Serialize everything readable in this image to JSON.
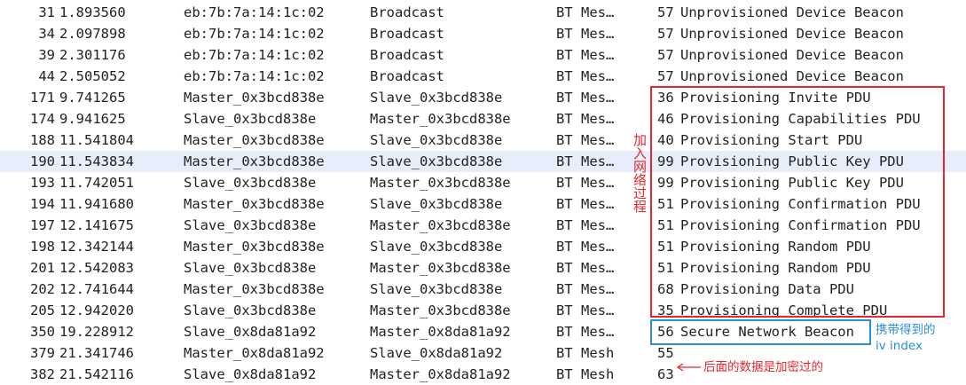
{
  "packets": [
    {
      "no": "31",
      "time": "1.893560",
      "source": "eb:7b:7a:14:1c:02",
      "destination": "Broadcast",
      "protocol": "BT Mes…",
      "length": "57",
      "info": "Unprovisioned Device Beacon"
    },
    {
      "no": "34",
      "time": "2.097898",
      "source": "eb:7b:7a:14:1c:02",
      "destination": "Broadcast",
      "protocol": "BT Mes…",
      "length": "57",
      "info": "Unprovisioned Device Beacon"
    },
    {
      "no": "39",
      "time": "2.301176",
      "source": "eb:7b:7a:14:1c:02",
      "destination": "Broadcast",
      "protocol": "BT Mes…",
      "length": "57",
      "info": "Unprovisioned Device Beacon"
    },
    {
      "no": "44",
      "time": "2.505052",
      "source": "eb:7b:7a:14:1c:02",
      "destination": "Broadcast",
      "protocol": "BT Mes…",
      "length": "57",
      "info": "Unprovisioned Device Beacon"
    },
    {
      "no": "171",
      "time": "9.741265",
      "source": "Master_0x3bcd838e",
      "destination": "Slave_0x3bcd838e",
      "protocol": "BT Mes…",
      "length": "36",
      "info": "Provisioning Invite PDU"
    },
    {
      "no": "174",
      "time": "9.941625",
      "source": "Slave_0x3bcd838e",
      "destination": "Master_0x3bcd838e",
      "protocol": "BT Mes…",
      "length": "46",
      "info": "Provisioning Capabilities PDU"
    },
    {
      "no": "188",
      "time": "11.541804",
      "source": "Master_0x3bcd838e",
      "destination": "Slave_0x3bcd838e",
      "protocol": "BT Mes…",
      "length": "40",
      "info": "Provisioning Start PDU"
    },
    {
      "no": "190",
      "time": "11.543834",
      "source": "Master_0x3bcd838e",
      "destination": "Slave_0x3bcd838e",
      "protocol": "BT Mes…",
      "length": "99",
      "info": "Provisioning Public Key PDU",
      "selected": true
    },
    {
      "no": "193",
      "time": "11.742051",
      "source": "Slave_0x3bcd838e",
      "destination": "Master_0x3bcd838e",
      "protocol": "BT Mes…",
      "length": "99",
      "info": "Provisioning Public Key PDU"
    },
    {
      "no": "194",
      "time": "11.941680",
      "source": "Master_0x3bcd838e",
      "destination": "Slave_0x3bcd838e",
      "protocol": "BT Mes…",
      "length": "51",
      "info": "Provisioning Confirmation PDU"
    },
    {
      "no": "197",
      "time": "12.141675",
      "source": "Slave_0x3bcd838e",
      "destination": "Master_0x3bcd838e",
      "protocol": "BT Mes…",
      "length": "51",
      "info": "Provisioning Confirmation PDU"
    },
    {
      "no": "198",
      "time": "12.342144",
      "source": "Master_0x3bcd838e",
      "destination": "Slave_0x3bcd838e",
      "protocol": "BT Mes…",
      "length": "51",
      "info": "Provisioning Random PDU"
    },
    {
      "no": "201",
      "time": "12.542083",
      "source": "Slave_0x3bcd838e",
      "destination": "Master_0x3bcd838e",
      "protocol": "BT Mes…",
      "length": "51",
      "info": "Provisioning Random PDU"
    },
    {
      "no": "202",
      "time": "12.741644",
      "source": "Master_0x3bcd838e",
      "destination": "Slave_0x3bcd838e",
      "protocol": "BT Mes…",
      "length": "68",
      "info": "Provisioning Data PDU"
    },
    {
      "no": "205",
      "time": "12.942020",
      "source": "Slave_0x3bcd838e",
      "destination": "Master_0x3bcd838e",
      "protocol": "BT Mes…",
      "length": "35",
      "info": "Provisioning Complete PDU"
    },
    {
      "no": "350",
      "time": "19.228912",
      "source": "Slave_0x8da81a92",
      "destination": "Master_0x8da81a92",
      "protocol": "BT Mes…",
      "length": "56",
      "info": "Secure Network Beacon"
    },
    {
      "no": "379",
      "time": "21.341746",
      "source": "Master_0x8da81a92",
      "destination": "Slave_0x8da81a92",
      "protocol": "BT Mesh",
      "length": "55",
      "info": ""
    },
    {
      "no": "382",
      "time": "21.542116",
      "source": "Slave_0x8da81a92",
      "destination": "Master_0x8da81a92",
      "protocol": "BT Mesh",
      "length": "63",
      "info": ""
    }
  ],
  "annotations": {
    "provisioning_label": "加入网络过程",
    "beacon_note_line1": "携带得到的",
    "beacon_note_line2": "iv index",
    "encrypted_note": "后面的数据是加密过的"
  },
  "colors": {
    "annotation_red": "#e8262d",
    "annotation_blue": "#2a8dd6",
    "selected_row_bg": "#e6eefb",
    "text": "#222222"
  }
}
